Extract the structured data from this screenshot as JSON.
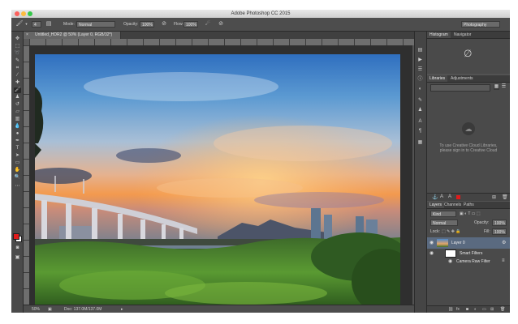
{
  "app": {
    "title": "Adobe Photoshop CC 2015"
  },
  "options_bar": {
    "mode_label": "Mode:",
    "mode_value": "Normal",
    "opacity_label": "Opacity:",
    "opacity_value": "100%",
    "flow_label": "Flow:",
    "flow_value": "100%",
    "brush_size": "4",
    "workspace": "Photography"
  },
  "document": {
    "tab_label": "Untitled_HDR2 @ 50% (Layer 0, RGB/32*)"
  },
  "status": {
    "zoom": "50%",
    "doc": "Doc: 137.0M/137.0M"
  },
  "histogram_panel": {
    "tabs": [
      "Histogram",
      "Navigator"
    ]
  },
  "libraries_panel": {
    "tabs": [
      "Libraries",
      "Adjustments"
    ],
    "message": "To use Creative Cloud Libraries, please sign in to Creative Cloud"
  },
  "layers_panel": {
    "tabs": [
      "Layers",
      "Channels",
      "Paths"
    ],
    "kind_value": "Kind",
    "blend_value": "Normal",
    "opacity_label": "Opacity:",
    "opacity_value": "100%",
    "lock_label": "Lock:",
    "fill_label": "Fill:",
    "fill_value": "100%",
    "layers": [
      {
        "name": "Layer 0"
      },
      {
        "name": "Smart Filters"
      },
      {
        "name": "Camera Raw Filter"
      }
    ]
  },
  "colors": {
    "foreground": "#e01b1b",
    "background": "#ffffff"
  }
}
